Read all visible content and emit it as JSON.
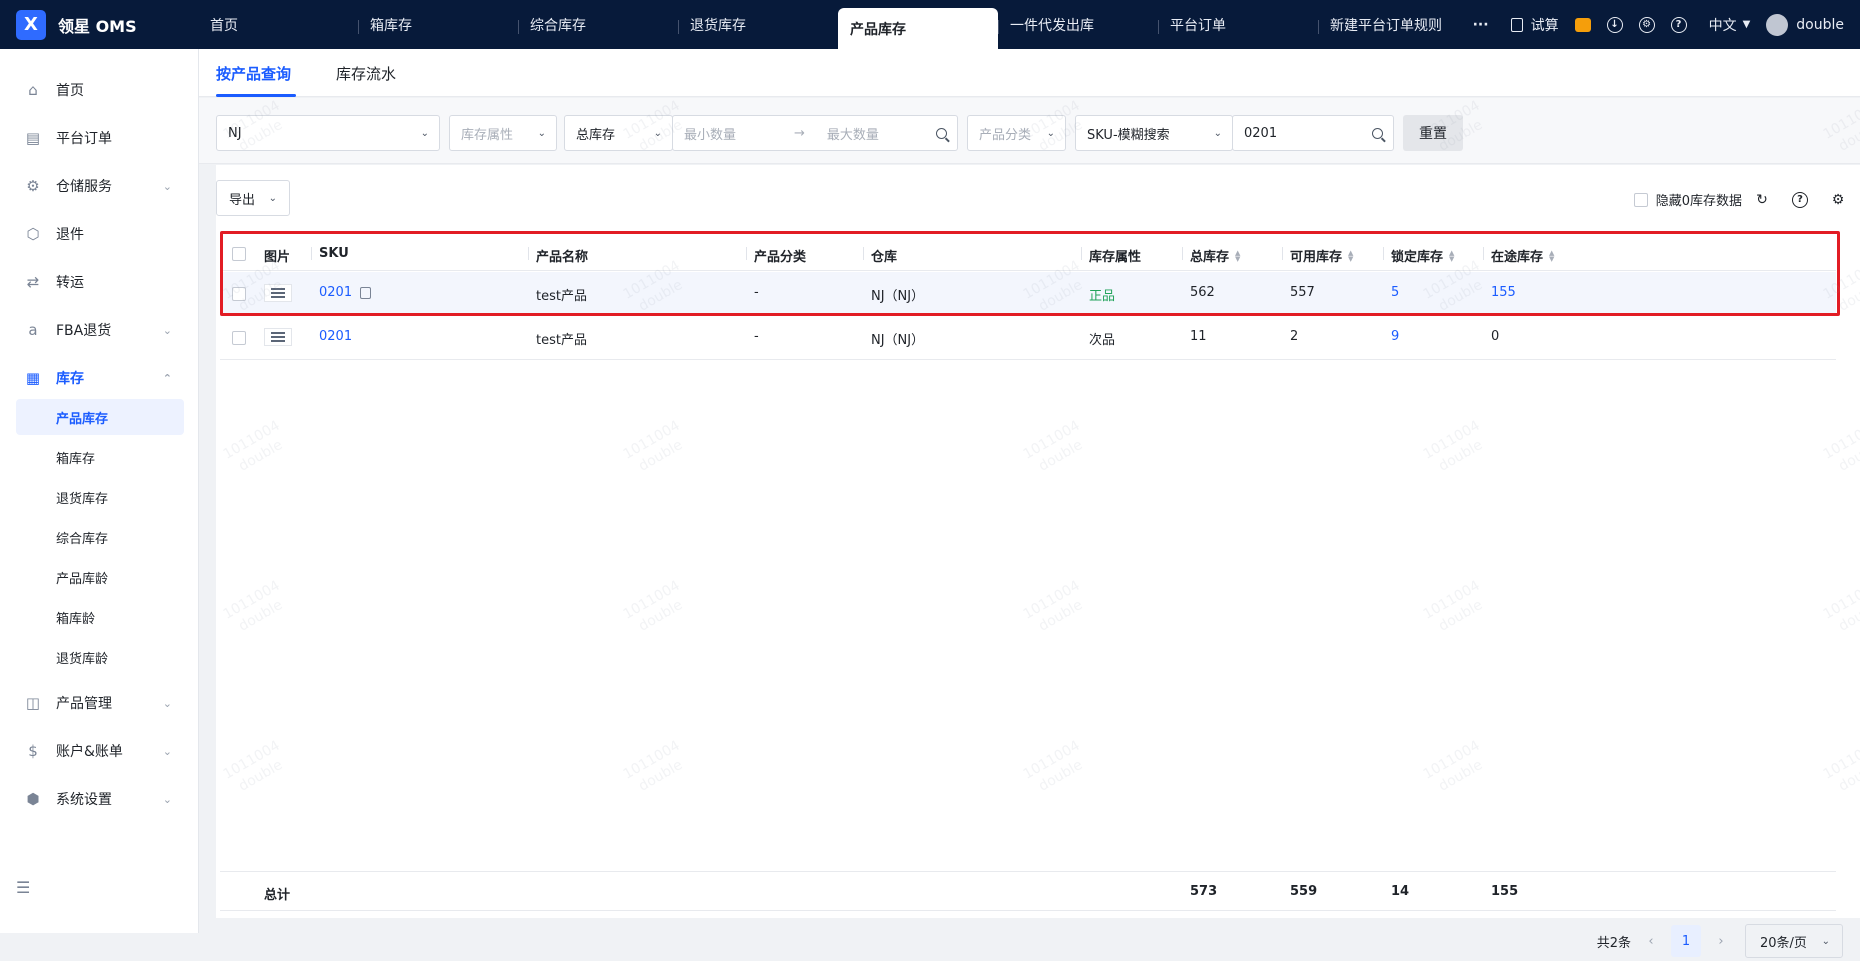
{
  "app": {
    "name": "领星 OMS",
    "logo_glyph": "X"
  },
  "top_nav": {
    "tabs": [
      "首页",
      "箱库存",
      "综合库存",
      "退货库存",
      "产品库存",
      "一件代发出库",
      "平台订单",
      "新建平台订单规则"
    ],
    "active_tab": "产品库存",
    "more": "···",
    "calc_label": "试算",
    "lang": "中文",
    "user": "double"
  },
  "sidebar": {
    "items": [
      {
        "label": "首页",
        "icon": "home-icon",
        "glyph": "⌂",
        "expandable": false
      },
      {
        "label": "平台订单",
        "icon": "order-icon",
        "glyph": "▤",
        "expandable": false
      },
      {
        "label": "仓储服务",
        "icon": "warehouse-service-icon",
        "glyph": "⚙",
        "expandable": true
      },
      {
        "label": "退件",
        "icon": "return-icon",
        "glyph": "⬡",
        "expandable": false
      },
      {
        "label": "转运",
        "icon": "transfer-icon",
        "glyph": "⇄",
        "expandable": false
      },
      {
        "label": "FBA退货",
        "icon": "fba-icon",
        "glyph": "a",
        "expandable": true
      },
      {
        "label": "库存",
        "icon": "inventory-icon",
        "glyph": "▦",
        "expandable": true,
        "expanded": true
      },
      {
        "label": "产品管理",
        "icon": "product-icon",
        "glyph": "◫",
        "expandable": true
      },
      {
        "label": "账户&账单",
        "icon": "account-icon",
        "glyph": "$",
        "expandable": true
      },
      {
        "label": "系统设置",
        "icon": "settings-icon",
        "glyph": "⬢",
        "expandable": true
      }
    ],
    "inventory_sub": [
      "产品库存",
      "箱库存",
      "退货库存",
      "综合库存",
      "产品库龄",
      "箱库龄",
      "退货库龄"
    ],
    "active_sub": "产品库存",
    "collapse_glyph": "☰"
  },
  "page_tabs": [
    "按产品查询",
    "库存流水"
  ],
  "filters": {
    "warehouse": "NJ",
    "stock_attr_placeholder": "库存属性",
    "qty_type": "总库存",
    "min_placeholder": "最小数量",
    "arrow": "→",
    "max_placeholder": "最大数量",
    "category_placeholder": "产品分类",
    "search_mode": "SKU-模糊搜索",
    "search_value": "0201",
    "reset_label": "重置"
  },
  "toolbar": {
    "export_label": "导出",
    "hide_zero_label": "隐藏0库存数据",
    "refresh_glyph": "↻",
    "help_glyph": "?",
    "settings_glyph": "⚙"
  },
  "table": {
    "headers": [
      "图片",
      "SKU",
      "产品名称",
      "产品分类",
      "仓库",
      "库存属性",
      "总库存",
      "可用库存",
      "锁定库存",
      "在途库存"
    ],
    "sort_up": "▲",
    "sort_down": "▼",
    "rows": [
      {
        "sku": "0201",
        "name": "test产品",
        "category": "-",
        "warehouse": "NJ（NJ）",
        "attr": "正品",
        "total": "562",
        "available": "557",
        "locked": "5",
        "transit": "155"
      },
      {
        "sku": "0201",
        "name": "test产品",
        "category": "-",
        "warehouse": "NJ（NJ）",
        "attr": "次品",
        "total": "11",
        "available": "2",
        "locked": "9",
        "transit": "0"
      }
    ],
    "total_label": "总计",
    "totals": {
      "total": "573",
      "available": "559",
      "locked": "14",
      "transit": "155"
    }
  },
  "pagination": {
    "count_text": "共2条",
    "prev": "‹",
    "current": "1",
    "next": "›",
    "page_size": "20条/页"
  },
  "watermark": {
    "line1": "1011004",
    "line2": "double"
  },
  "colors": {
    "topbar": "#071a3a",
    "accent": "#1b5cff",
    "highlight_border": "#e21c24",
    "good_attr": "#22a35a"
  }
}
